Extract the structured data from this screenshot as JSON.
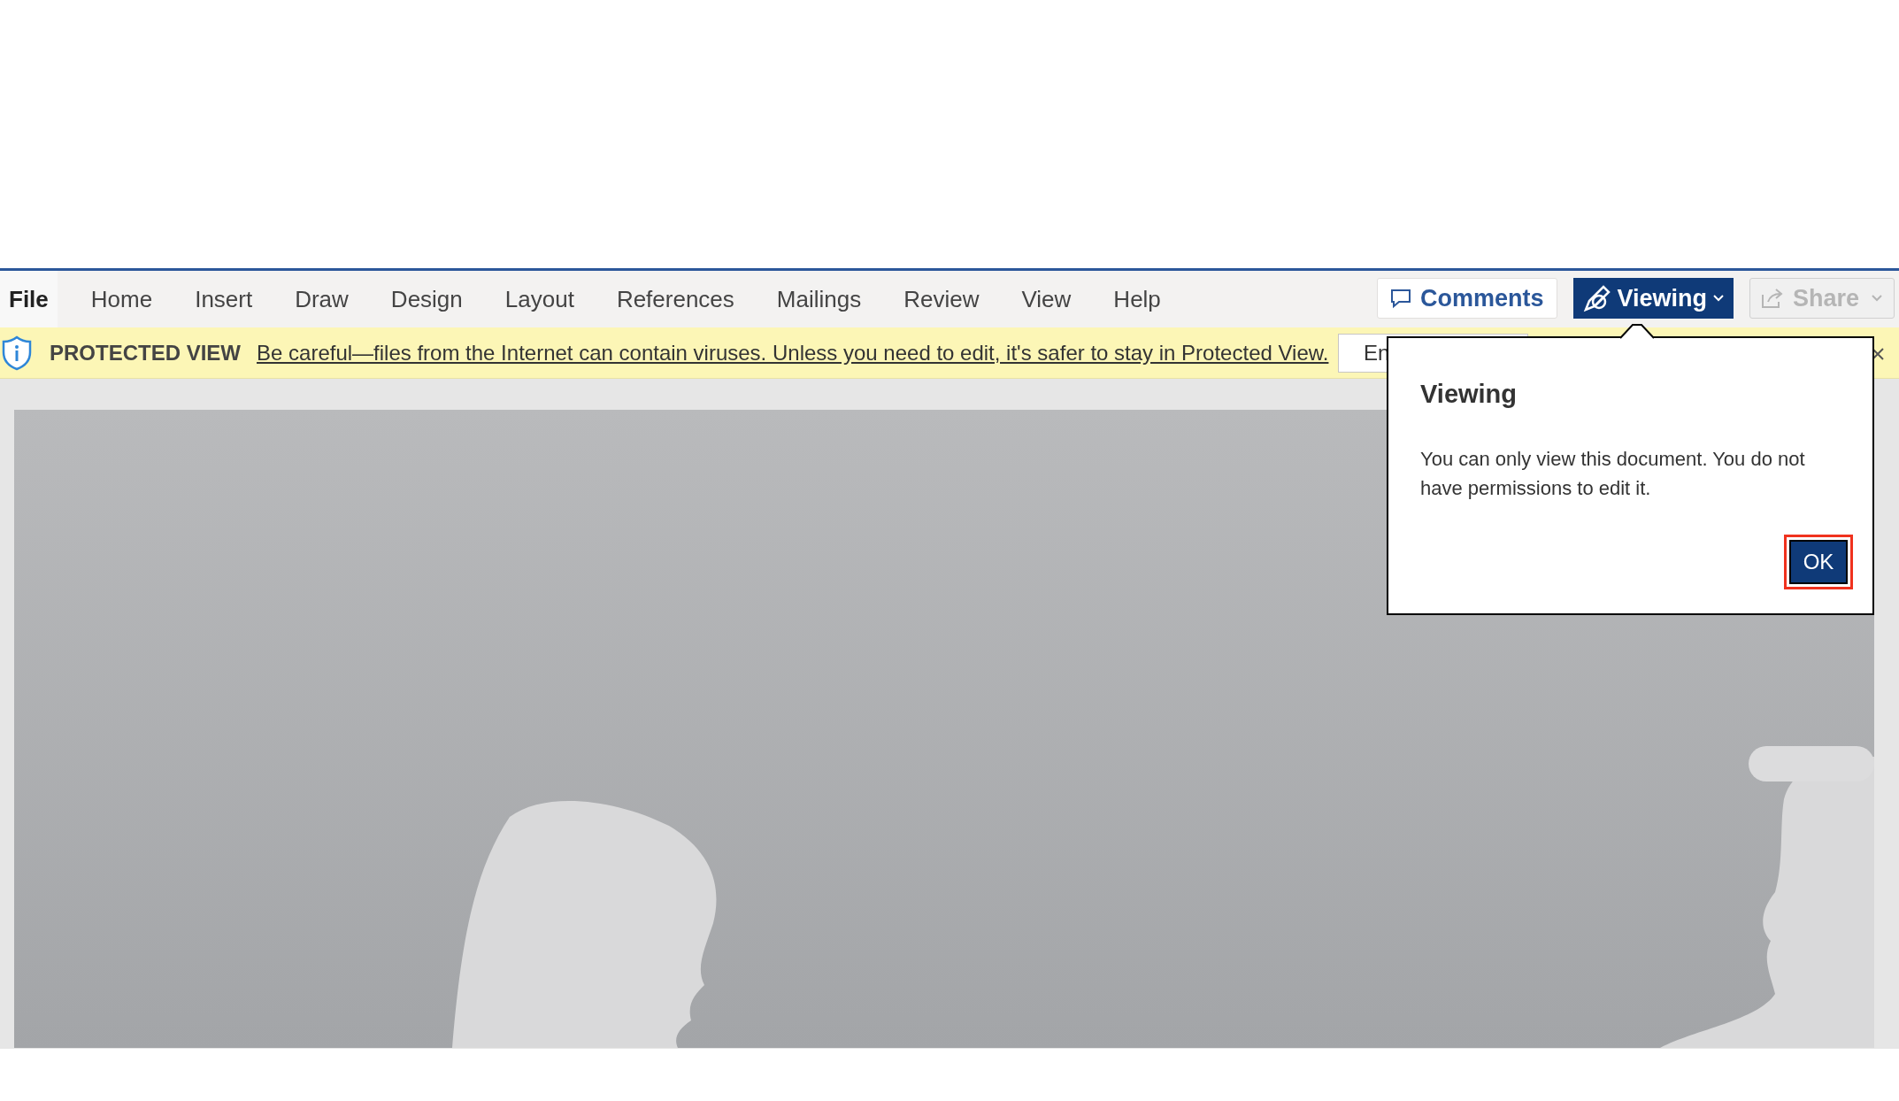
{
  "ribbon": {
    "tabs": [
      {
        "label": "File",
        "selected": true
      },
      {
        "label": "Home",
        "selected": false
      },
      {
        "label": "Insert",
        "selected": false
      },
      {
        "label": "Draw",
        "selected": false
      },
      {
        "label": "Design",
        "selected": false
      },
      {
        "label": "Layout",
        "selected": false
      },
      {
        "label": "References",
        "selected": false
      },
      {
        "label": "Mailings",
        "selected": false
      },
      {
        "label": "Review",
        "selected": false
      },
      {
        "label": "View",
        "selected": false
      },
      {
        "label": "Help",
        "selected": false
      }
    ],
    "comments_button": {
      "label": "Comments"
    },
    "mode_button": {
      "label": "Viewing"
    },
    "share_button": {
      "label": "Share",
      "disabled": true
    }
  },
  "protected_view_bar": {
    "title": "PROTECTED VIEW",
    "message": "Be careful—files from the Internet can contain viruses. Unless you need to edit, it's safer to stay in Protected View.",
    "button": "En"
  },
  "popup": {
    "title": "Viewing",
    "message": "You can only view this document. You do not have permissions to edit it.",
    "ok_button": {
      "label": "OK",
      "highlighted": true
    }
  }
}
